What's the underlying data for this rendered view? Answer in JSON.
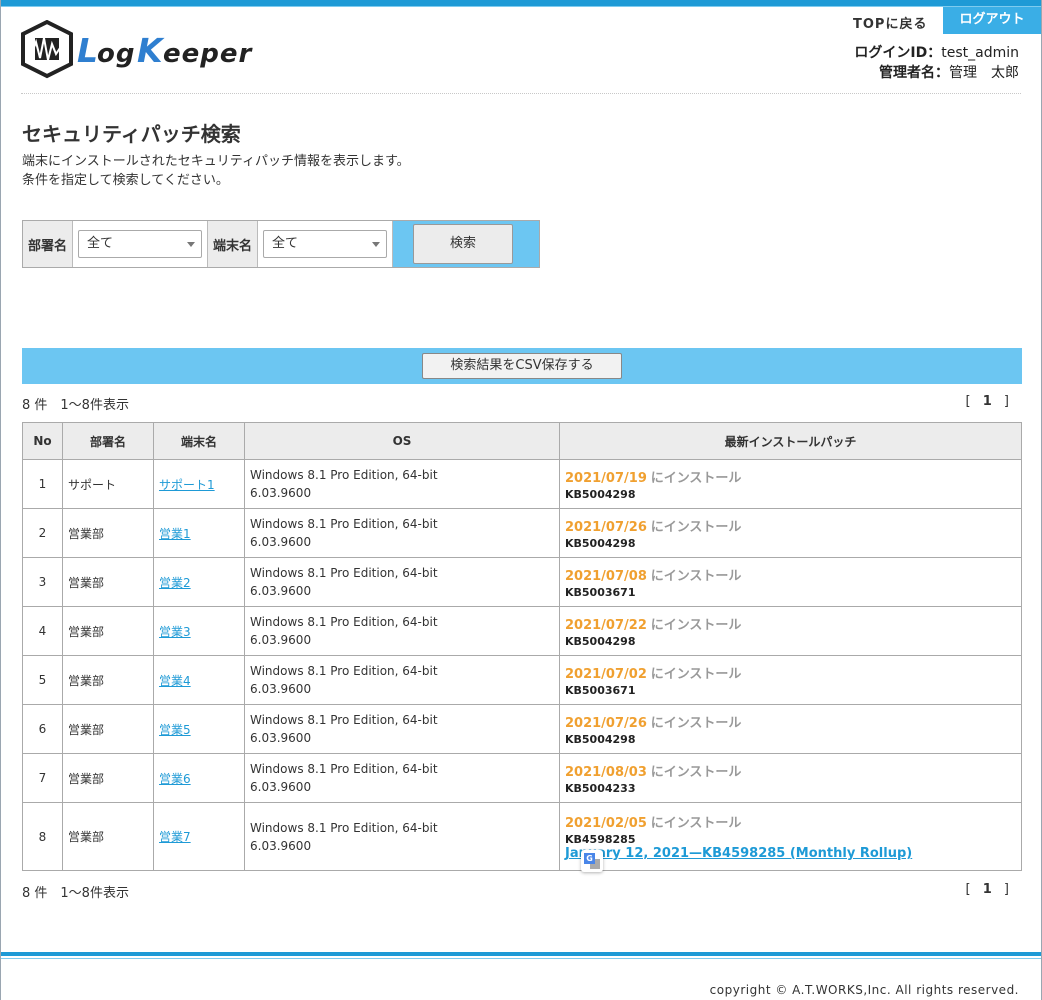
{
  "header": {
    "app_name": "LogKeeper",
    "top_link": "TOPに戻る",
    "logout": "ログアウト",
    "login_id_label": "ログインID：",
    "login_id_value": "test_admin",
    "admin_name_label": "管理者名：",
    "admin_name_value": "管理　太郎"
  },
  "page": {
    "title": "セキュリティパッチ検索",
    "desc_line1": "端末にインストールされたセキュリティパッチ情報を表示します。",
    "desc_line2": "条件を指定して検索してください。"
  },
  "search": {
    "dept_label": "部署名",
    "dept_value": "全て",
    "terminal_label": "端末名",
    "terminal_value": "全て",
    "button": "検索"
  },
  "csv_button": "検索結果をCSV保存する",
  "result_count": "8 件　1～8件表示",
  "pager": {
    "open": "[",
    "page": "1",
    "close": "]"
  },
  "table": {
    "headers": {
      "no": "No",
      "dept": "部署名",
      "terminal": "端末名",
      "os": "OS",
      "patch": "最新インストールパッチ"
    },
    "rows": [
      {
        "no": "1",
        "dept": "サポート",
        "terminal": "サポート1",
        "os1": "Windows 8.1 Pro Edition, 64-bit",
        "os2": "6.03.9600",
        "date": "2021/07/19",
        "suffix": "にインストール",
        "kb": "KB5004298"
      },
      {
        "no": "2",
        "dept": "営業部",
        "terminal": "営業1",
        "os1": "Windows 8.1 Pro Edition, 64-bit",
        "os2": "6.03.9600",
        "date": "2021/07/26",
        "suffix": "にインストール",
        "kb": "KB5004298"
      },
      {
        "no": "3",
        "dept": "営業部",
        "terminal": "営業2",
        "os1": "Windows 8.1 Pro Edition, 64-bit",
        "os2": "6.03.9600",
        "date": "2021/07/08",
        "suffix": "にインストール",
        "kb": "KB5003671"
      },
      {
        "no": "4",
        "dept": "営業部",
        "terminal": "営業3",
        "os1": "Windows 8.1 Pro Edition, 64-bit",
        "os2": "6.03.9600",
        "date": "2021/07/22",
        "suffix": "にインストール",
        "kb": "KB5004298"
      },
      {
        "no": "5",
        "dept": "営業部",
        "terminal": "営業4",
        "os1": "Windows 8.1 Pro Edition, 64-bit",
        "os2": "6.03.9600",
        "date": "2021/07/02",
        "suffix": "にインストール",
        "kb": "KB5003671"
      },
      {
        "no": "6",
        "dept": "営業部",
        "terminal": "営業5",
        "os1": "Windows 8.1 Pro Edition, 64-bit",
        "os2": "6.03.9600",
        "date": "2021/07/26",
        "suffix": "にインストール",
        "kb": "KB5004298"
      },
      {
        "no": "7",
        "dept": "営業部",
        "terminal": "営業6",
        "os1": "Windows 8.1 Pro Edition, 64-bit",
        "os2": "6.03.9600",
        "date": "2021/08/03",
        "suffix": "にインストール",
        "kb": "KB5004233"
      },
      {
        "no": "8",
        "dept": "営業部",
        "terminal": "営業7",
        "os1": "Windows 8.1 Pro Edition, 64-bit",
        "os2": "6.03.9600",
        "date": "2021/02/05",
        "suffix": "にインストール",
        "kb": "KB4598285",
        "kb_link": "January 12, 2021—KB4598285 (Monthly Rollup)"
      }
    ]
  },
  "footer": {
    "copyright": "copyright © A.T.WORKS,Inc. All rights reserved."
  }
}
